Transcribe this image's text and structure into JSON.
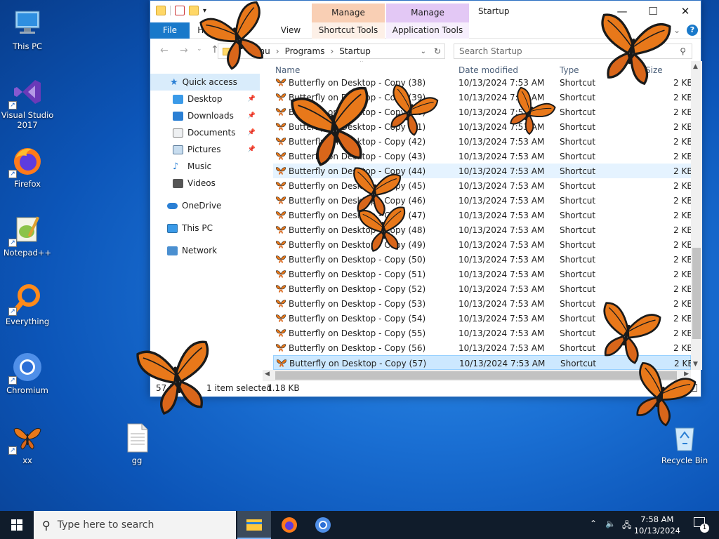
{
  "desktop": {
    "icons": [
      {
        "label": "This PC",
        "icon": "this-pc-icon"
      },
      {
        "label": "Visual Studio 2017",
        "icon": "visual-studio-icon"
      },
      {
        "label": "Firefox",
        "icon": "firefox-icon"
      },
      {
        "label": "Notepad++",
        "icon": "notepadpp-icon"
      },
      {
        "label": "Everything",
        "icon": "everything-icon"
      },
      {
        "label": "Chromium",
        "icon": "chromium-icon"
      },
      {
        "label": "xx",
        "icon": "butterfly-icon"
      },
      {
        "label": "gg",
        "icon": "text-file-icon"
      },
      {
        "label": "Recycle Bin",
        "icon": "recycle-bin-icon"
      }
    ]
  },
  "explorer": {
    "window_title": "Startup",
    "context_tabs": [
      {
        "group": "Manage",
        "tab": "Shortcut Tools",
        "color": "#f9cfb4"
      },
      {
        "group": "Manage",
        "tab": "Application Tools",
        "color": "#e3c8f5"
      }
    ],
    "ribbon_tabs": [
      "File",
      "Home",
      "View"
    ],
    "address": [
      "Menu",
      "Programs",
      "Startup"
    ],
    "search_placeholder": "Search Startup",
    "nav": {
      "quick_access": "Quick access",
      "items": [
        {
          "label": "Desktop",
          "pinned": true
        },
        {
          "label": "Downloads",
          "pinned": true
        },
        {
          "label": "Documents",
          "pinned": true
        },
        {
          "label": "Pictures",
          "pinned": true
        },
        {
          "label": "Music",
          "pinned": false
        },
        {
          "label": "Videos",
          "pinned": false
        }
      ],
      "onedrive": "OneDrive",
      "this_pc": "This PC",
      "network": "Network"
    },
    "columns": {
      "name": "Name",
      "date": "Date modified",
      "type": "Type",
      "size": "Size"
    },
    "rows": [
      {
        "name": "Butterfly on Desktop - Copy (38)",
        "date": "10/13/2024 7:53 AM",
        "type": "Shortcut",
        "size": "2 KB"
      },
      {
        "name": "Butterfly on Desktop - Copy (39)",
        "date": "10/13/2024 7:53 AM",
        "type": "Shortcut",
        "size": "2 KB"
      },
      {
        "name": "Butterfly on Desktop - Copy (40)",
        "date": "10/13/2024 7:53 AM",
        "type": "Shortcut",
        "size": "2 KB"
      },
      {
        "name": "Butterfly on Desktop - Copy (41)",
        "date": "10/13/2024 7:53 AM",
        "type": "Shortcut",
        "size": "2 KB"
      },
      {
        "name": "Butterfly on Desktop - Copy (42)",
        "date": "10/13/2024 7:53 AM",
        "type": "Shortcut",
        "size": "2 KB"
      },
      {
        "name": "Butterfly on Desktop - Copy (43)",
        "date": "10/13/2024 7:53 AM",
        "type": "Shortcut",
        "size": "2 KB"
      },
      {
        "name": "Butterfly on Desktop - Copy (44)",
        "date": "10/13/2024 7:53 AM",
        "type": "Shortcut",
        "size": "2 KB"
      },
      {
        "name": "Butterfly on Desktop - Copy (45)",
        "date": "10/13/2024 7:53 AM",
        "type": "Shortcut",
        "size": "2 KB"
      },
      {
        "name": "Butterfly on Desktop - Copy (46)",
        "date": "10/13/2024 7:53 AM",
        "type": "Shortcut",
        "size": "2 KB"
      },
      {
        "name": "Butterfly on Desktop - Copy (47)",
        "date": "10/13/2024 7:53 AM",
        "type": "Shortcut",
        "size": "2 KB"
      },
      {
        "name": "Butterfly on Desktop - Copy (48)",
        "date": "10/13/2024 7:53 AM",
        "type": "Shortcut",
        "size": "2 KB"
      },
      {
        "name": "Butterfly on Desktop - Copy (49)",
        "date": "10/13/2024 7:53 AM",
        "type": "Shortcut",
        "size": "2 KB"
      },
      {
        "name": "Butterfly on Desktop - Copy (50)",
        "date": "10/13/2024 7:53 AM",
        "type": "Shortcut",
        "size": "2 KB"
      },
      {
        "name": "Butterfly on Desktop - Copy (51)",
        "date": "10/13/2024 7:53 AM",
        "type": "Shortcut",
        "size": "2 KB"
      },
      {
        "name": "Butterfly on Desktop - Copy (52)",
        "date": "10/13/2024 7:53 AM",
        "type": "Shortcut",
        "size": "2 KB"
      },
      {
        "name": "Butterfly on Desktop - Copy (53)",
        "date": "10/13/2024 7:53 AM",
        "type": "Shortcut",
        "size": "2 KB"
      },
      {
        "name": "Butterfly on Desktop - Copy (54)",
        "date": "10/13/2024 7:53 AM",
        "type": "Shortcut",
        "size": "2 KB"
      },
      {
        "name": "Butterfly on Desktop - Copy (55)",
        "date": "10/13/2024 7:53 AM",
        "type": "Shortcut",
        "size": "2 KB"
      },
      {
        "name": "Butterfly on Desktop - Copy (56)",
        "date": "10/13/2024 7:53 AM",
        "type": "Shortcut",
        "size": "2 KB"
      },
      {
        "name": "Butterfly on Desktop - Copy (57)",
        "date": "10/13/2024 7:53 AM",
        "type": "Shortcut",
        "size": "2 KB"
      }
    ],
    "status": {
      "count": "57 items",
      "selected": "1 item selected",
      "size": "1.18 KB"
    }
  },
  "taskbar": {
    "search_placeholder": "Type here to search",
    "time": "7:58 AM",
    "date": "10/13/2024",
    "notification_count": "1",
    "apps": [
      "file-explorer-icon",
      "firefox-icon",
      "chromium-icon"
    ]
  },
  "colors": {
    "butterfly_orange": "#e8781a",
    "selection": "#cce8ff",
    "file_tab_blue": "#1979ca"
  }
}
